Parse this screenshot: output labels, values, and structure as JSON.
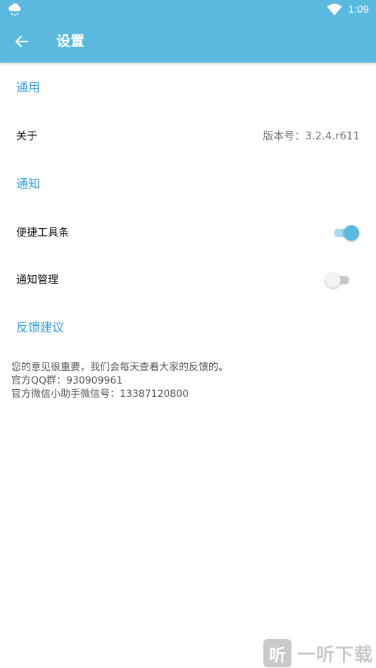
{
  "status_bar": {
    "time": "1:09",
    "icons": [
      "weather-cloud-icon",
      "wifi-icon"
    ]
  },
  "app_bar": {
    "title": "设置",
    "back_icon": "arrow-left-icon"
  },
  "sections": {
    "general": {
      "header": "通用",
      "about": {
        "label": "关于",
        "value": "版本号：3.2.4.r611"
      }
    },
    "notifications": {
      "header": "通知",
      "shortcut_toolbar": {
        "label": "便捷工具条",
        "enabled": true
      },
      "notification_management": {
        "label": "通知管理",
        "enabled": false
      }
    },
    "feedback": {
      "header": "反馈建议",
      "lines": [
        "您的意见很重要，我们会每天查看大家的反馈的。",
        "官方QQ群：930909961",
        "官方微信小助手微信号：13387120800"
      ]
    }
  },
  "watermark": {
    "logo_char": "听",
    "text": "一听下载"
  },
  "colors": {
    "primary": "#5bb9df",
    "accent_text": "#3aa0dc",
    "switch_track_on": "#a9d8ef",
    "switch_track_off": "#c7c7c7"
  }
}
